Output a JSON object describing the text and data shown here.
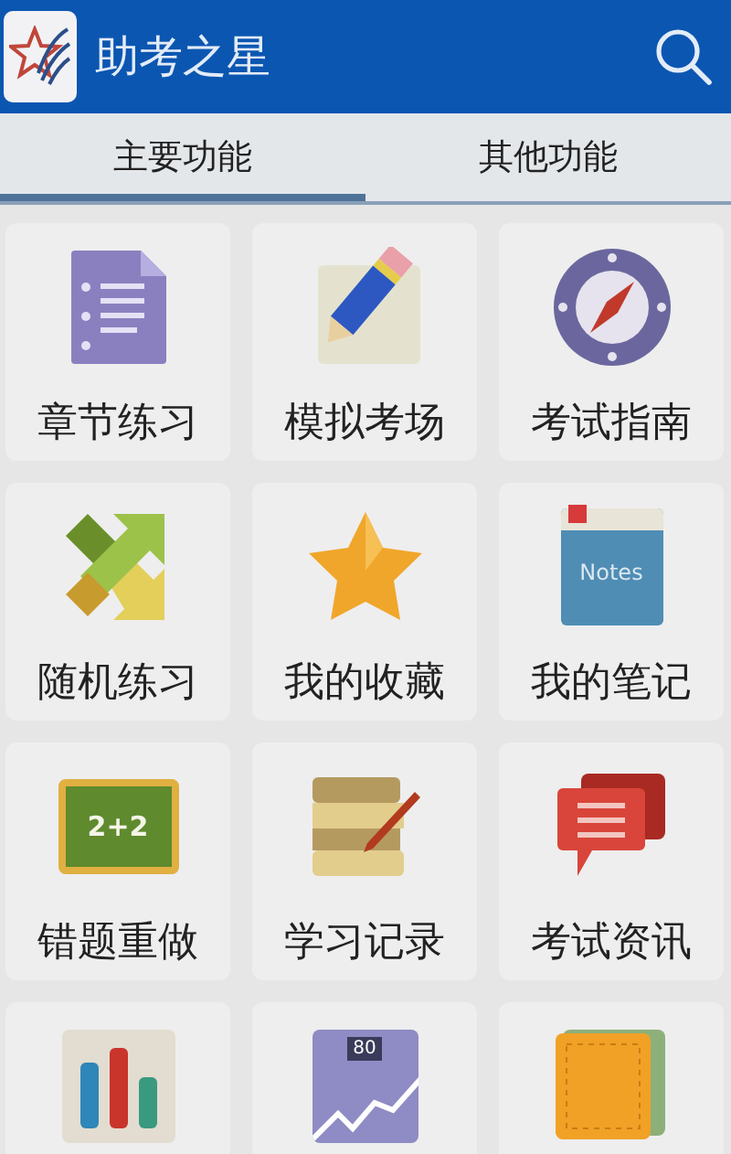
{
  "app_bar": {
    "title": "助考之星"
  },
  "tabs": [
    {
      "label": "主要功能",
      "selected": true
    },
    {
      "label": "其他功能",
      "selected": false
    }
  ],
  "tiles": [
    {
      "kind": "document",
      "label": "章节练习"
    },
    {
      "kind": "pencil",
      "label": "模拟考场"
    },
    {
      "kind": "compass",
      "label": "考试指南"
    },
    {
      "kind": "arrows",
      "label": "随机练习"
    },
    {
      "kind": "star",
      "label": "我的收藏"
    },
    {
      "kind": "notebook",
      "label": "我的笔记",
      "icon_text": "Notes"
    },
    {
      "kind": "chalkboard",
      "label": "错题重做",
      "icon_text": "2+2"
    },
    {
      "kind": "scroll",
      "label": "学习记录"
    },
    {
      "kind": "chat",
      "label": "考试资讯"
    },
    {
      "kind": "barchart"
    },
    {
      "kind": "graph",
      "icon_text": "80"
    },
    {
      "kind": "wallet"
    }
  ]
}
